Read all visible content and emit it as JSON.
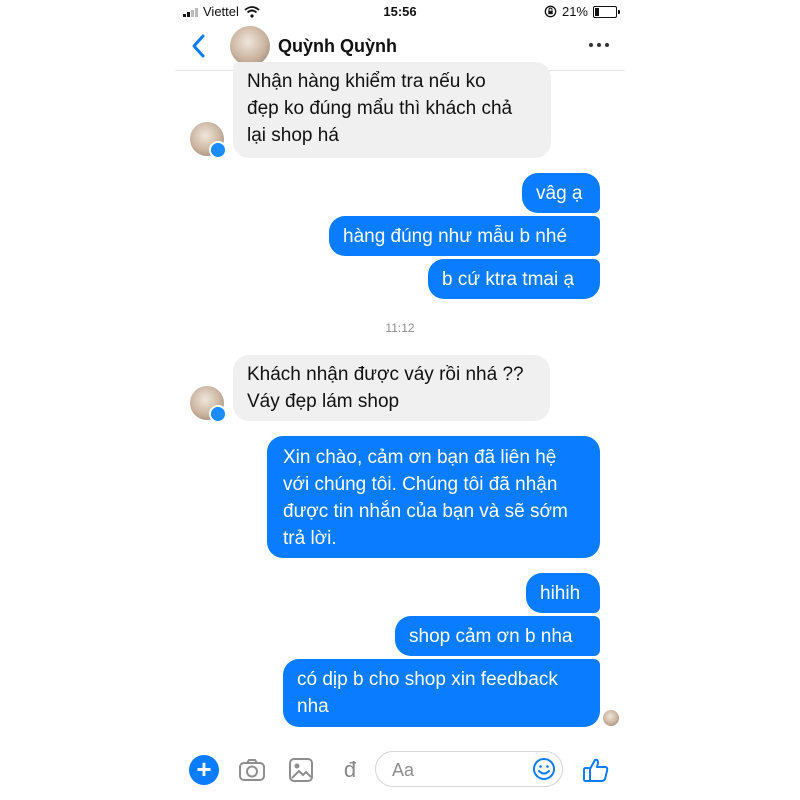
{
  "status": {
    "carrier": "Viettel",
    "time": "15:56",
    "battery": "21%"
  },
  "header": {
    "contact_name": "Quỳnh Quỳnh"
  },
  "messages": [
    {
      "lines": [
        "Nhận hàng khiểm tra nếu ko",
        "đẹp ko đúng mẩu thì khách chả",
        "lại shop há"
      ]
    },
    {
      "lines": [
        "vâg ạ"
      ]
    },
    {
      "lines": [
        "hàng đúng như mẫu b nhé"
      ]
    },
    {
      "lines": [
        "b cứ ktra tmai ạ"
      ]
    },
    {
      "lines": [
        "Khách nhận được váy rồi nhá ??",
        "Váy đẹp lám shop"
      ]
    },
    {
      "lines": [
        "Xin chào, cảm ơn bạn đã liên hệ",
        "với chúng tôi. Chúng tôi đã nhận",
        "được tin nhắn của bạn và sẽ sớm",
        "trả lời."
      ]
    },
    {
      "lines": [
        "hihih"
      ]
    },
    {
      "lines": [
        "shop cảm ơn b nha"
      ]
    },
    {
      "lines": [
        "có dịp b cho shop xin feedback",
        "nha"
      ]
    }
  ],
  "timestamp": "11:12",
  "composer": {
    "placeholder": "Aa",
    "currency_symbol": "đ"
  },
  "icons": [
    "back-icon",
    "more-icon",
    "add-icon",
    "camera-icon",
    "gallery-icon",
    "emoji-icon",
    "like-icon",
    "messenger-badge-icon"
  ],
  "colors": {
    "accent": "#0a7cff",
    "incoming_bubble": "#f0f0f0"
  }
}
